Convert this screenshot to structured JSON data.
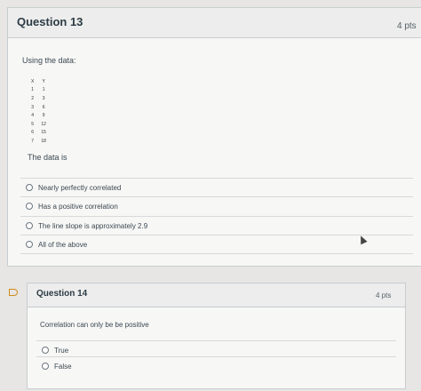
{
  "q13": {
    "title": "Question 13",
    "points": "4 pts",
    "prompt": "Using the data:",
    "table": {
      "headers": [
        "X",
        "Y"
      ],
      "rows": [
        [
          "1",
          "1"
        ],
        [
          "2",
          "3"
        ],
        [
          "3",
          "6"
        ],
        [
          "4",
          "9"
        ],
        [
          "5",
          "12"
        ],
        [
          "6",
          "15"
        ],
        [
          "7",
          "18"
        ]
      ]
    },
    "subprompt": "The data is",
    "answers": [
      "Nearly perfectly correlated",
      "Has a positive correlation",
      "The line slope is approximately 2.9",
      "All of the above"
    ]
  },
  "q14": {
    "title": "Question 14",
    "points": "4 pts",
    "prompt": "Correlation can only be be positive",
    "answers": [
      "True",
      "False"
    ]
  },
  "colors": {
    "accent_flag": "#d08b1a",
    "text": "#2d3b45",
    "border": "#c7cdd1"
  }
}
